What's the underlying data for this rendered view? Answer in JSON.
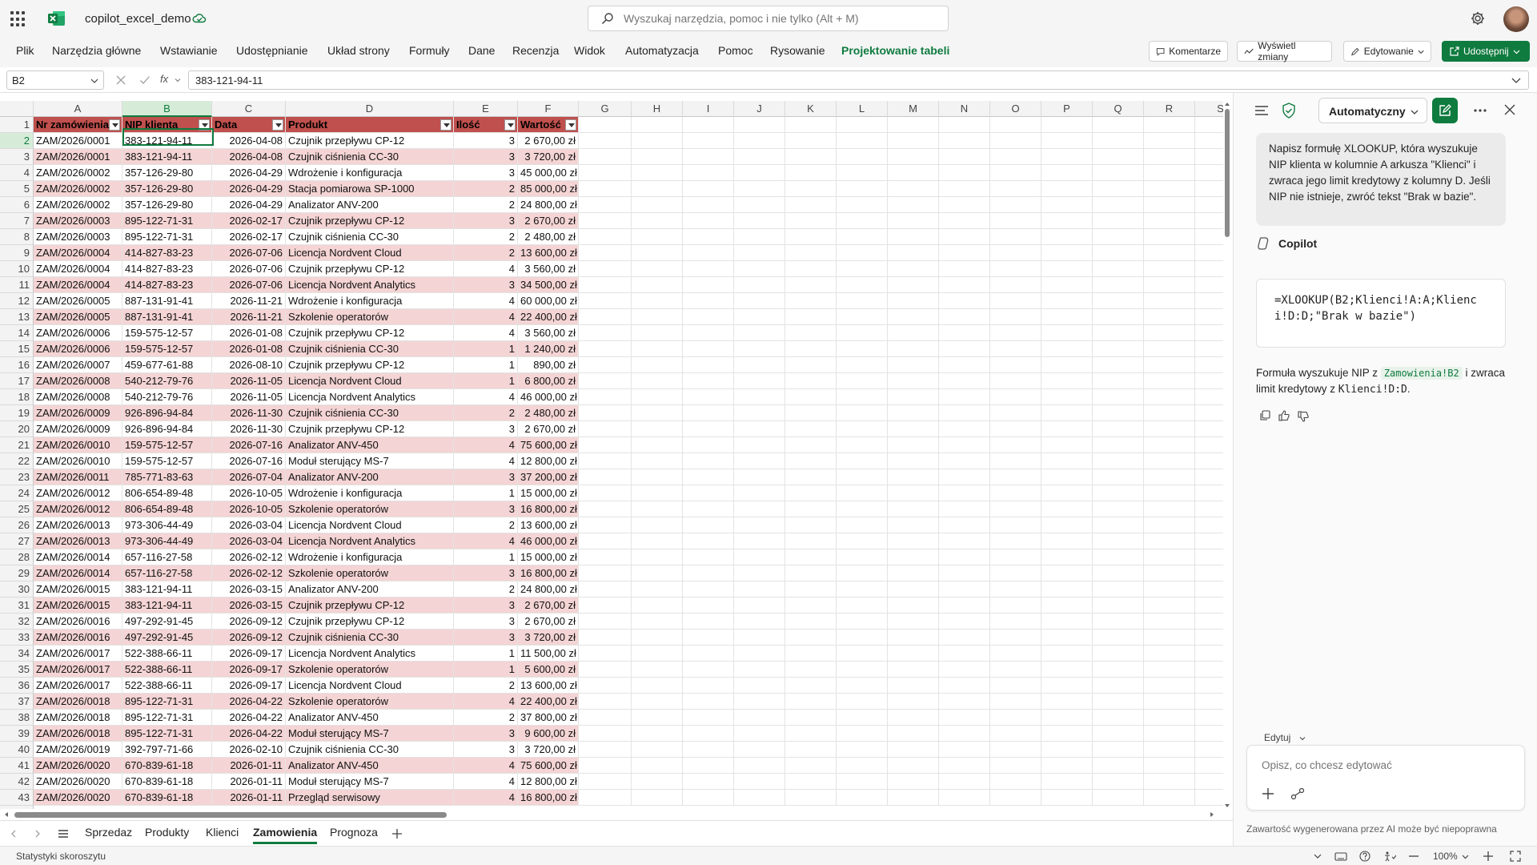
{
  "app": {
    "title": "copilot_excel_demo",
    "search_placeholder": "Wyszukaj narzędzia, pomoc i nie tylko (Alt + M)"
  },
  "menu": [
    "Plik",
    "Narzędzia główne",
    "Wstawianie",
    "Udostępnianie",
    "Układ strony",
    "Formuły",
    "Dane",
    "Recenzja",
    "Widok",
    "Automatyzacja",
    "Pomoc",
    "Rysowanie",
    "Projektowanie tabeli"
  ],
  "ribbon_buttons": {
    "comments": "Komentarze",
    "changes": "Wyświetl zmiany",
    "editing": "Edytowanie",
    "share": "Udostępnij"
  },
  "formula_bar": {
    "name_box": "B2",
    "fx": "fx",
    "formula": "383-121-94-11"
  },
  "columns": [
    "A",
    "B",
    "C",
    "D",
    "E",
    "F",
    "G",
    "H",
    "I",
    "J",
    "K",
    "L",
    "M",
    "N",
    "O",
    "P",
    "Q",
    "R",
    "S"
  ],
  "table_headers": [
    "Nr zamówienia",
    "NIP klienta",
    "Data",
    "Produkt",
    "Ilość",
    "Wartość"
  ],
  "rows": [
    [
      "ZAM/2026/0001",
      "383-121-94-11",
      "2026-04-08",
      "Czujnik przepływu CP-12",
      "3",
      "2 670,00 zł"
    ],
    [
      "ZAM/2026/0001",
      "383-121-94-11",
      "2026-04-08",
      "Czujnik ciśnienia CC-30",
      "3",
      "3 720,00 zł"
    ],
    [
      "ZAM/2026/0002",
      "357-126-29-80",
      "2026-04-29",
      "Wdrożenie i konfiguracja",
      "3",
      "45 000,00 zł"
    ],
    [
      "ZAM/2026/0002",
      "357-126-29-80",
      "2026-04-29",
      "Stacja pomiarowa SP-1000",
      "2",
      "85 000,00 zł"
    ],
    [
      "ZAM/2026/0002",
      "357-126-29-80",
      "2026-04-29",
      "Analizator ANV-200",
      "2",
      "24 800,00 zł"
    ],
    [
      "ZAM/2026/0003",
      "895-122-71-31",
      "2026-02-17",
      "Czujnik przepływu CP-12",
      "3",
      "2 670,00 zł"
    ],
    [
      "ZAM/2026/0003",
      "895-122-71-31",
      "2026-02-17",
      "Czujnik ciśnienia CC-30",
      "2",
      "2 480,00 zł"
    ],
    [
      "ZAM/2026/0004",
      "414-827-83-23",
      "2026-07-06",
      "Licencja Nordvent Cloud",
      "2",
      "13 600,00 zł"
    ],
    [
      "ZAM/2026/0004",
      "414-827-83-23",
      "2026-07-06",
      "Czujnik przepływu CP-12",
      "4",
      "3 560,00 zł"
    ],
    [
      "ZAM/2026/0004",
      "414-827-83-23",
      "2026-07-06",
      "Licencja Nordvent Analytics",
      "3",
      "34 500,00 zł"
    ],
    [
      "ZAM/2026/0005",
      "887-131-91-41",
      "2026-11-21",
      "Wdrożenie i konfiguracja",
      "4",
      "60 000,00 zł"
    ],
    [
      "ZAM/2026/0005",
      "887-131-91-41",
      "2026-11-21",
      "Szkolenie operatorów",
      "4",
      "22 400,00 zł"
    ],
    [
      "ZAM/2026/0006",
      "159-575-12-57",
      "2026-01-08",
      "Czujnik przepływu CP-12",
      "4",
      "3 560,00 zł"
    ],
    [
      "ZAM/2026/0006",
      "159-575-12-57",
      "2026-01-08",
      "Czujnik ciśnienia CC-30",
      "1",
      "1 240,00 zł"
    ],
    [
      "ZAM/2026/0007",
      "459-677-61-88",
      "2026-08-10",
      "Czujnik przepływu CP-12",
      "1",
      "890,00 zł"
    ],
    [
      "ZAM/2026/0008",
      "540-212-79-76",
      "2026-11-05",
      "Licencja Nordvent Cloud",
      "1",
      "6 800,00 zł"
    ],
    [
      "ZAM/2026/0008",
      "540-212-79-76",
      "2026-11-05",
      "Licencja Nordvent Analytics",
      "4",
      "46 000,00 zł"
    ],
    [
      "ZAM/2026/0009",
      "926-896-94-84",
      "2026-11-30",
      "Czujnik ciśnienia CC-30",
      "2",
      "2 480,00 zł"
    ],
    [
      "ZAM/2026/0009",
      "926-896-94-84",
      "2026-11-30",
      "Czujnik przepływu CP-12",
      "3",
      "2 670,00 zł"
    ],
    [
      "ZAM/2026/0010",
      "159-575-12-57",
      "2026-07-16",
      "Analizator ANV-450",
      "4",
      "75 600,00 zł"
    ],
    [
      "ZAM/2026/0010",
      "159-575-12-57",
      "2026-07-16",
      "Moduł sterujący MS-7",
      "4",
      "12 800,00 zł"
    ],
    [
      "ZAM/2026/0011",
      "785-771-83-63",
      "2026-07-04",
      "Analizator ANV-200",
      "3",
      "37 200,00 zł"
    ],
    [
      "ZAM/2026/0012",
      "806-654-89-48",
      "2026-10-05",
      "Wdrożenie i konfiguracja",
      "1",
      "15 000,00 zł"
    ],
    [
      "ZAM/2026/0012",
      "806-654-89-48",
      "2026-10-05",
      "Szkolenie operatorów",
      "3",
      "16 800,00 zł"
    ],
    [
      "ZAM/2026/0013",
      "973-306-44-49",
      "2026-03-04",
      "Licencja Nordvent Cloud",
      "2",
      "13 600,00 zł"
    ],
    [
      "ZAM/2026/0013",
      "973-306-44-49",
      "2026-03-04",
      "Licencja Nordvent Analytics",
      "4",
      "46 000,00 zł"
    ],
    [
      "ZAM/2026/0014",
      "657-116-27-58",
      "2026-02-12",
      "Wdrożenie i konfiguracja",
      "1",
      "15 000,00 zł"
    ],
    [
      "ZAM/2026/0014",
      "657-116-27-58",
      "2026-02-12",
      "Szkolenie operatorów",
      "3",
      "16 800,00 zł"
    ],
    [
      "ZAM/2026/0015",
      "383-121-94-11",
      "2026-03-15",
      "Analizator ANV-200",
      "2",
      "24 800,00 zł"
    ],
    [
      "ZAM/2026/0015",
      "383-121-94-11",
      "2026-03-15",
      "Czujnik przepływu CP-12",
      "3",
      "2 670,00 zł"
    ],
    [
      "ZAM/2026/0016",
      "497-292-91-45",
      "2026-09-12",
      "Czujnik przepływu CP-12",
      "3",
      "2 670,00 zł"
    ],
    [
      "ZAM/2026/0016",
      "497-292-91-45",
      "2026-09-12",
      "Czujnik ciśnienia CC-30",
      "3",
      "3 720,00 zł"
    ],
    [
      "ZAM/2026/0017",
      "522-388-66-11",
      "2026-09-17",
      "Licencja Nordvent Analytics",
      "1",
      "11 500,00 zł"
    ],
    [
      "ZAM/2026/0017",
      "522-388-66-11",
      "2026-09-17",
      "Szkolenie operatorów",
      "1",
      "5 600,00 zł"
    ],
    [
      "ZAM/2026/0017",
      "522-388-66-11",
      "2026-09-17",
      "Licencja Nordvent Cloud",
      "2",
      "13 600,00 zł"
    ],
    [
      "ZAM/2026/0018",
      "895-122-71-31",
      "2026-04-22",
      "Szkolenie operatorów",
      "4",
      "22 400,00 zł"
    ],
    [
      "ZAM/2026/0018",
      "895-122-71-31",
      "2026-04-22",
      "Analizator ANV-450",
      "2",
      "37 800,00 zł"
    ],
    [
      "ZAM/2026/0018",
      "895-122-71-31",
      "2026-04-22",
      "Moduł sterujący MS-7",
      "3",
      "9 600,00 zł"
    ],
    [
      "ZAM/2026/0019",
      "392-797-71-66",
      "2026-02-10",
      "Czujnik ciśnienia CC-30",
      "3",
      "3 720,00 zł"
    ],
    [
      "ZAM/2026/0020",
      "670-839-61-18",
      "2026-01-11",
      "Analizator ANV-450",
      "4",
      "75 600,00 zł"
    ],
    [
      "ZAM/2026/0020",
      "670-839-61-18",
      "2026-01-11",
      "Moduł sterujący MS-7",
      "4",
      "12 800,00 zł"
    ],
    [
      "ZAM/2026/0020",
      "670-839-61-18",
      "2026-01-11",
      "Przegląd serwisowy",
      "4",
      "16 800,00 zł"
    ]
  ],
  "sheet_tabs": [
    "Sprzedaz",
    "Produkty",
    "Klienci",
    "Zamowienia",
    "Prognoza"
  ],
  "active_sheet": "Zamowienia",
  "status": {
    "left": "Statystyki skoroszytu",
    "zoom": "100%"
  },
  "copilot": {
    "mode": "Automatyczny",
    "prompt": "Napisz formułę XLOOKUP, która wyszukuje NIP klienta w kolumnie A arkusza \"Klienci\" i zwraca jego limit kredytowy z kolumny D. Jeśli NIP nie istnieje, zwróć tekst \"Brak w bazie\".",
    "name": "Copilot",
    "formula": "=XLOOKUP(B2;Klienci!A:A;Klienci!D:D;\"Brak w bazie\")",
    "explain_1": "Formuła wyszukuje NIP z",
    "explain_code_1": "Zamowienia!B2",
    "explain_2": "i zwraca limit kredytowy z",
    "explain_code_2": "Klienci!D:D",
    "explain_3": ".",
    "edit_label": "Edytuj",
    "input_placeholder": "Opisz, co chcesz edytować",
    "disclaimer": "Zawartość wygenerowana przez AI może być niepoprawna"
  },
  "colors": {
    "accent": "#0f7b3f",
    "table_header": "#c0504d",
    "band": "#f4d4d4"
  }
}
